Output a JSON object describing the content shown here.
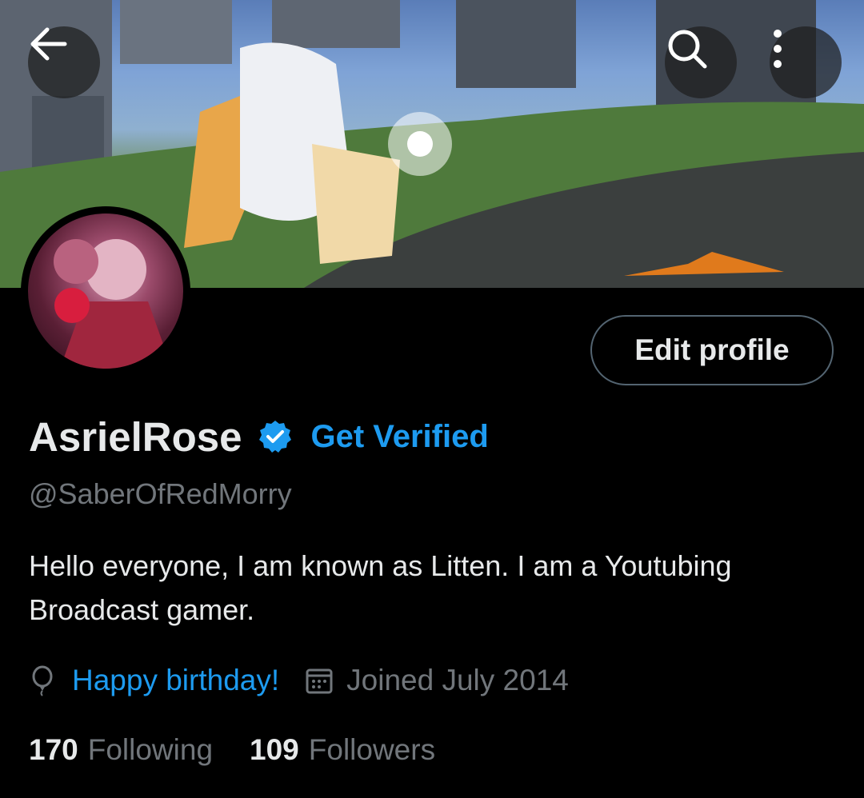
{
  "header": {
    "back_icon": "arrow-left-icon",
    "search_icon": "search-icon",
    "more_icon": "more-vertical-icon"
  },
  "profile": {
    "display_name": "AsrielRose",
    "verified_icon": "verified-badge-icon",
    "get_verified_label": "Get Verified",
    "handle": "@SaberOfRedMorry",
    "bio": "Hello everyone, I am known as Litten. I am a Youtubing Broadcast gamer.",
    "edit_profile_label": "Edit profile",
    "birthday_icon": "balloon-icon",
    "birthday_text": "Happy birthday!",
    "calendar_icon": "calendar-icon",
    "joined_text": "Joined July 2014"
  },
  "stats": {
    "following_count": "170",
    "following_label": "Following",
    "followers_count": "109",
    "followers_label": "Followers"
  },
  "colors": {
    "background": "#000000",
    "accent": "#1d9bf0",
    "secondary_text": "#71767b",
    "primary_text": "#e7e9ea"
  }
}
